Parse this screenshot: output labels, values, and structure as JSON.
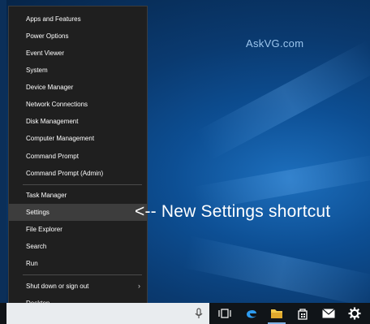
{
  "watermark": "AskVG.com",
  "annotation": "<-- New Settings shortcut",
  "menu": {
    "groups": [
      [
        "Apps and Features",
        "Power Options",
        "Event Viewer",
        "System",
        "Device Manager",
        "Network Connections",
        "Disk Management",
        "Computer Management",
        "Command Prompt",
        "Command Prompt (Admin)"
      ],
      [
        "Task Manager",
        "Settings",
        "File Explorer",
        "Search",
        "Run"
      ],
      [
        "Shut down or sign out",
        "Desktop"
      ]
    ],
    "highlighted": "Settings",
    "submenu_item": "Shut down or sign out"
  },
  "taskbar": {
    "icons": [
      "microphone-icon",
      "task-view-icon",
      "edge-icon",
      "file-explorer-icon",
      "store-icon",
      "mail-icon",
      "settings-gear-icon"
    ]
  },
  "colors": {
    "accent": "#7fb2e5",
    "menu_bg": "#1f1f1f",
    "highlight": "#3d3d3d"
  }
}
